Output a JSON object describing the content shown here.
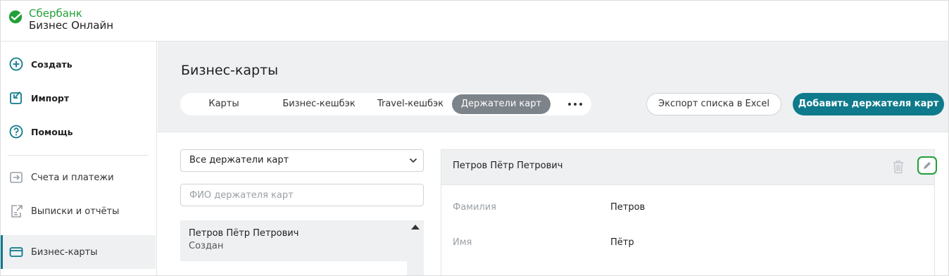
{
  "brand": {
    "line1": "Сбербанк",
    "line2": "Бизнес Онлайн",
    "color": "#21a038"
  },
  "sidebar": {
    "items": [
      {
        "label": "Создать",
        "icon": "plus-circle-icon"
      },
      {
        "label": "Импорт",
        "icon": "import-icon"
      },
      {
        "label": "Помощь",
        "icon": "help-icon"
      },
      {
        "label": "Счета и платежи",
        "icon": "arrow-box-icon"
      },
      {
        "label": "Выписки и отчёты",
        "icon": "document-export-icon"
      },
      {
        "label": "Бизнес-карты",
        "icon": "card-icon",
        "active": true
      }
    ]
  },
  "main": {
    "title": "Бизнес-карты",
    "tabs": [
      {
        "label": "Карты"
      },
      {
        "label": "Бизнес-кешбэк"
      },
      {
        "label": "Travel-кешбэк"
      },
      {
        "label": "Держатели карт",
        "active": true
      }
    ],
    "export_label": "Экспорт списка в Excel",
    "add_label": "Добавить держателя карт",
    "accent": "#0e7a8b"
  },
  "filter": {
    "select_value": "Все держатели карт",
    "search_placeholder": "ФИО держателя карт"
  },
  "holders": [
    {
      "name": "Петров Пётр Петрович",
      "status": "Создан"
    }
  ],
  "details": {
    "name": "Петров Пётр Петрович",
    "fields": [
      {
        "label": "Фамилия",
        "value": "Петров"
      },
      {
        "label": "Имя",
        "value": "Пётр"
      }
    ]
  }
}
